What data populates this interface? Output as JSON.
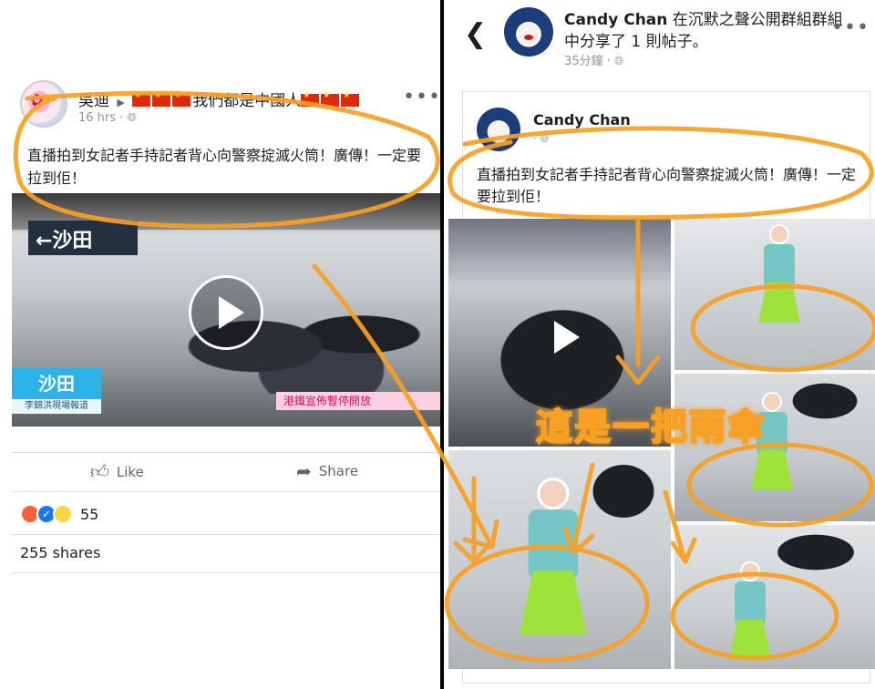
{
  "left_post": {
    "author": "吳迪",
    "group": "我們都是中國人",
    "time": "16 hrs",
    "text": "直播拍到女記者手持記者背心向警察掟滅火筒！廣傳！一定要拉到佢！",
    "video": {
      "station_sign": "←沙田",
      "location": "沙田",
      "location_sub": "李錦洪現場報道",
      "ticker": "港鐵宣佈暫停開放"
    },
    "like_label": "Like",
    "share_label": "Share",
    "reaction_count": "55",
    "shares": "255 shares"
  },
  "right_post": {
    "sharer": "Candy Chan",
    "share_action": "在沉默之聲公開群組群組中分享了 1 則帖子。",
    "time": "35分鐘",
    "original_author": "Candy Chan",
    "original_text": "直播拍到女記者手持記者背心向警察掟滅火筒！廣傳！一定要拉到佢！",
    "annotation_caption": "這是一把雨傘"
  },
  "icons": {
    "back": "chevron-left-icon",
    "more": "more-dots-icon",
    "globe": "globe-icon",
    "like": "thumbs-up-icon",
    "share": "share-arrow-icon"
  },
  "colors": {
    "annotation_orange": "#f7a024",
    "facebook_blue": "#1877f2",
    "umbrella_green": "#9ee23a"
  }
}
